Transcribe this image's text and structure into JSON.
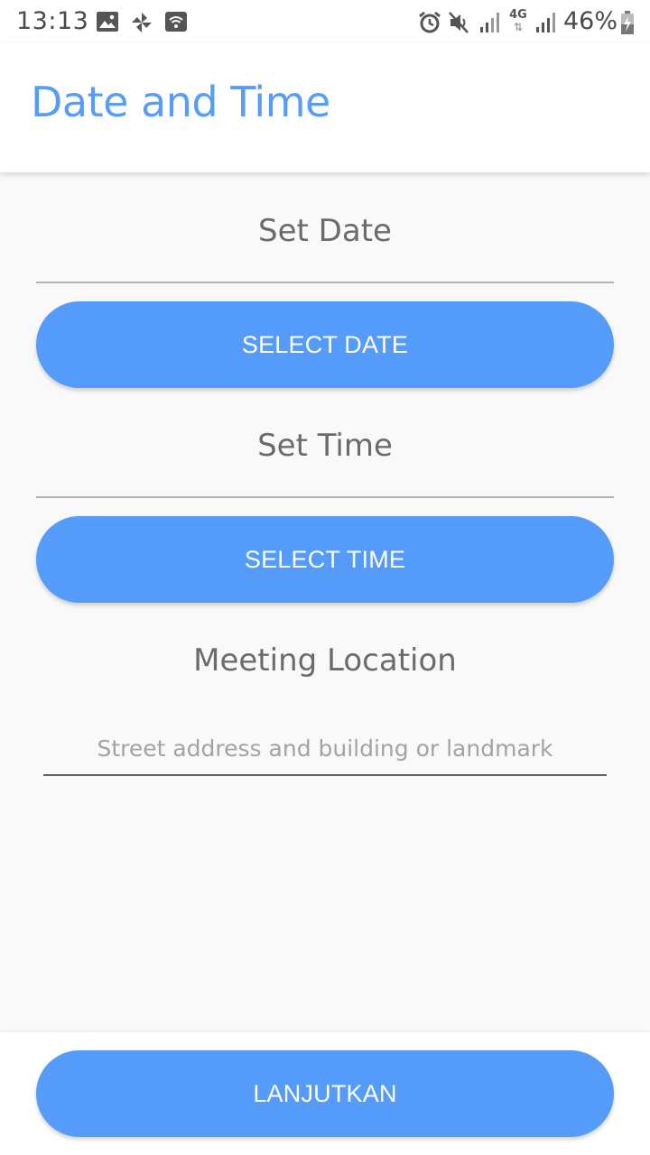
{
  "status_bar": {
    "time": "13:13",
    "battery_percent": "46%",
    "icons": [
      "gallery-icon",
      "pinwheel-icon",
      "wifi-icon",
      "alarm-icon",
      "mute-icon",
      "signal-icon",
      "4g-icon",
      "signal-icon",
      "battery-charging-icon"
    ],
    "network_label": "4G"
  },
  "app_bar": {
    "title": "Date and Time"
  },
  "date_section": {
    "label": "Set Date",
    "button_label": "SELECT DATE"
  },
  "time_section": {
    "label": "Set Time",
    "button_label": "SELECT TIME"
  },
  "location_section": {
    "label": "Meeting Location",
    "input_value": "",
    "placeholder": "Street address and building or landmark"
  },
  "footer": {
    "continue_label": "LANJUTKAN"
  },
  "colors": {
    "accent": "#559bf9",
    "title": "#579cf7",
    "label_text": "#6b6b6b",
    "background": "#f9f9f9"
  }
}
